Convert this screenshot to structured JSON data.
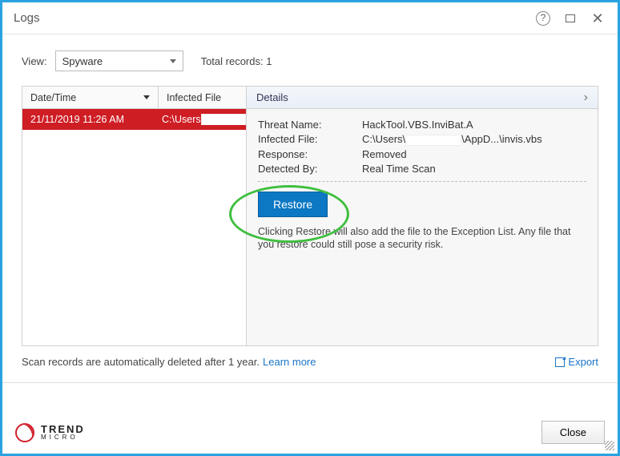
{
  "title": "Logs",
  "view": {
    "label": "View:",
    "selected": "Spyware"
  },
  "total_records": {
    "label": "Total records:",
    "value": "1"
  },
  "table": {
    "headers": {
      "datetime": "Date/Time",
      "infected_file": "Infected File"
    },
    "rows": [
      {
        "datetime": "21/11/2019 11:26 AM",
        "infected_file": "C:\\Users"
      }
    ]
  },
  "details": {
    "header": "Details",
    "threat_name": {
      "label": "Threat Name:",
      "value": "HackTool.VBS.InviBat.A"
    },
    "infected_file": {
      "label": "Infected File:",
      "prefix": "C:\\Users\\",
      "suffix": "\\AppD...\\invis.vbs"
    },
    "response": {
      "label": "Response:",
      "value": "Removed"
    },
    "detected_by": {
      "label": "Detected By:",
      "value": "Real Time Scan"
    },
    "restore_button": "Restore",
    "restore_note": "Clicking Restore will also add the file to the Exception List. Any file that you restore could still pose a security risk."
  },
  "auto_delete_note": "Scan records are automatically deleted after 1 year.",
  "learn_more": "Learn more",
  "export_label": "Export",
  "brand": {
    "top": "TREND",
    "bot": "MICRO"
  },
  "close_button": "Close"
}
